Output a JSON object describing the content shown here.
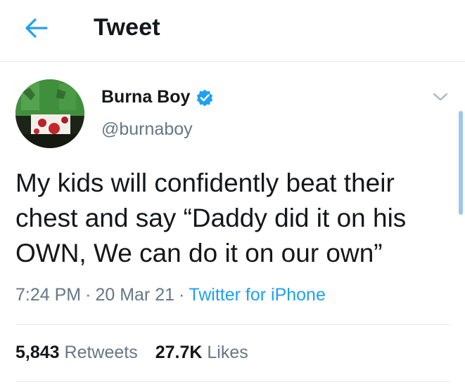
{
  "header": {
    "back_icon": "arrow-left-icon",
    "title": "Tweet"
  },
  "tweet": {
    "author": {
      "display_name": "Burna Boy",
      "handle": "@burnaboy",
      "verified_icon": "verified-badge-icon"
    },
    "text": "My kids will confidently beat their chest and say “Daddy did it on his OWN, We can do it on our own”",
    "time": "7:24 PM",
    "date": "20 Mar 21",
    "separator": "·",
    "source": "Twitter for iPhone",
    "stats": {
      "retweets_count": "5,843",
      "retweets_label": "Retweets",
      "likes_count": "27.7K",
      "likes_label": "Likes"
    }
  },
  "colors": {
    "accent": "#1da1f2",
    "text_primary": "#14171a",
    "text_secondary": "#657786",
    "divider": "#e6ecf0"
  }
}
